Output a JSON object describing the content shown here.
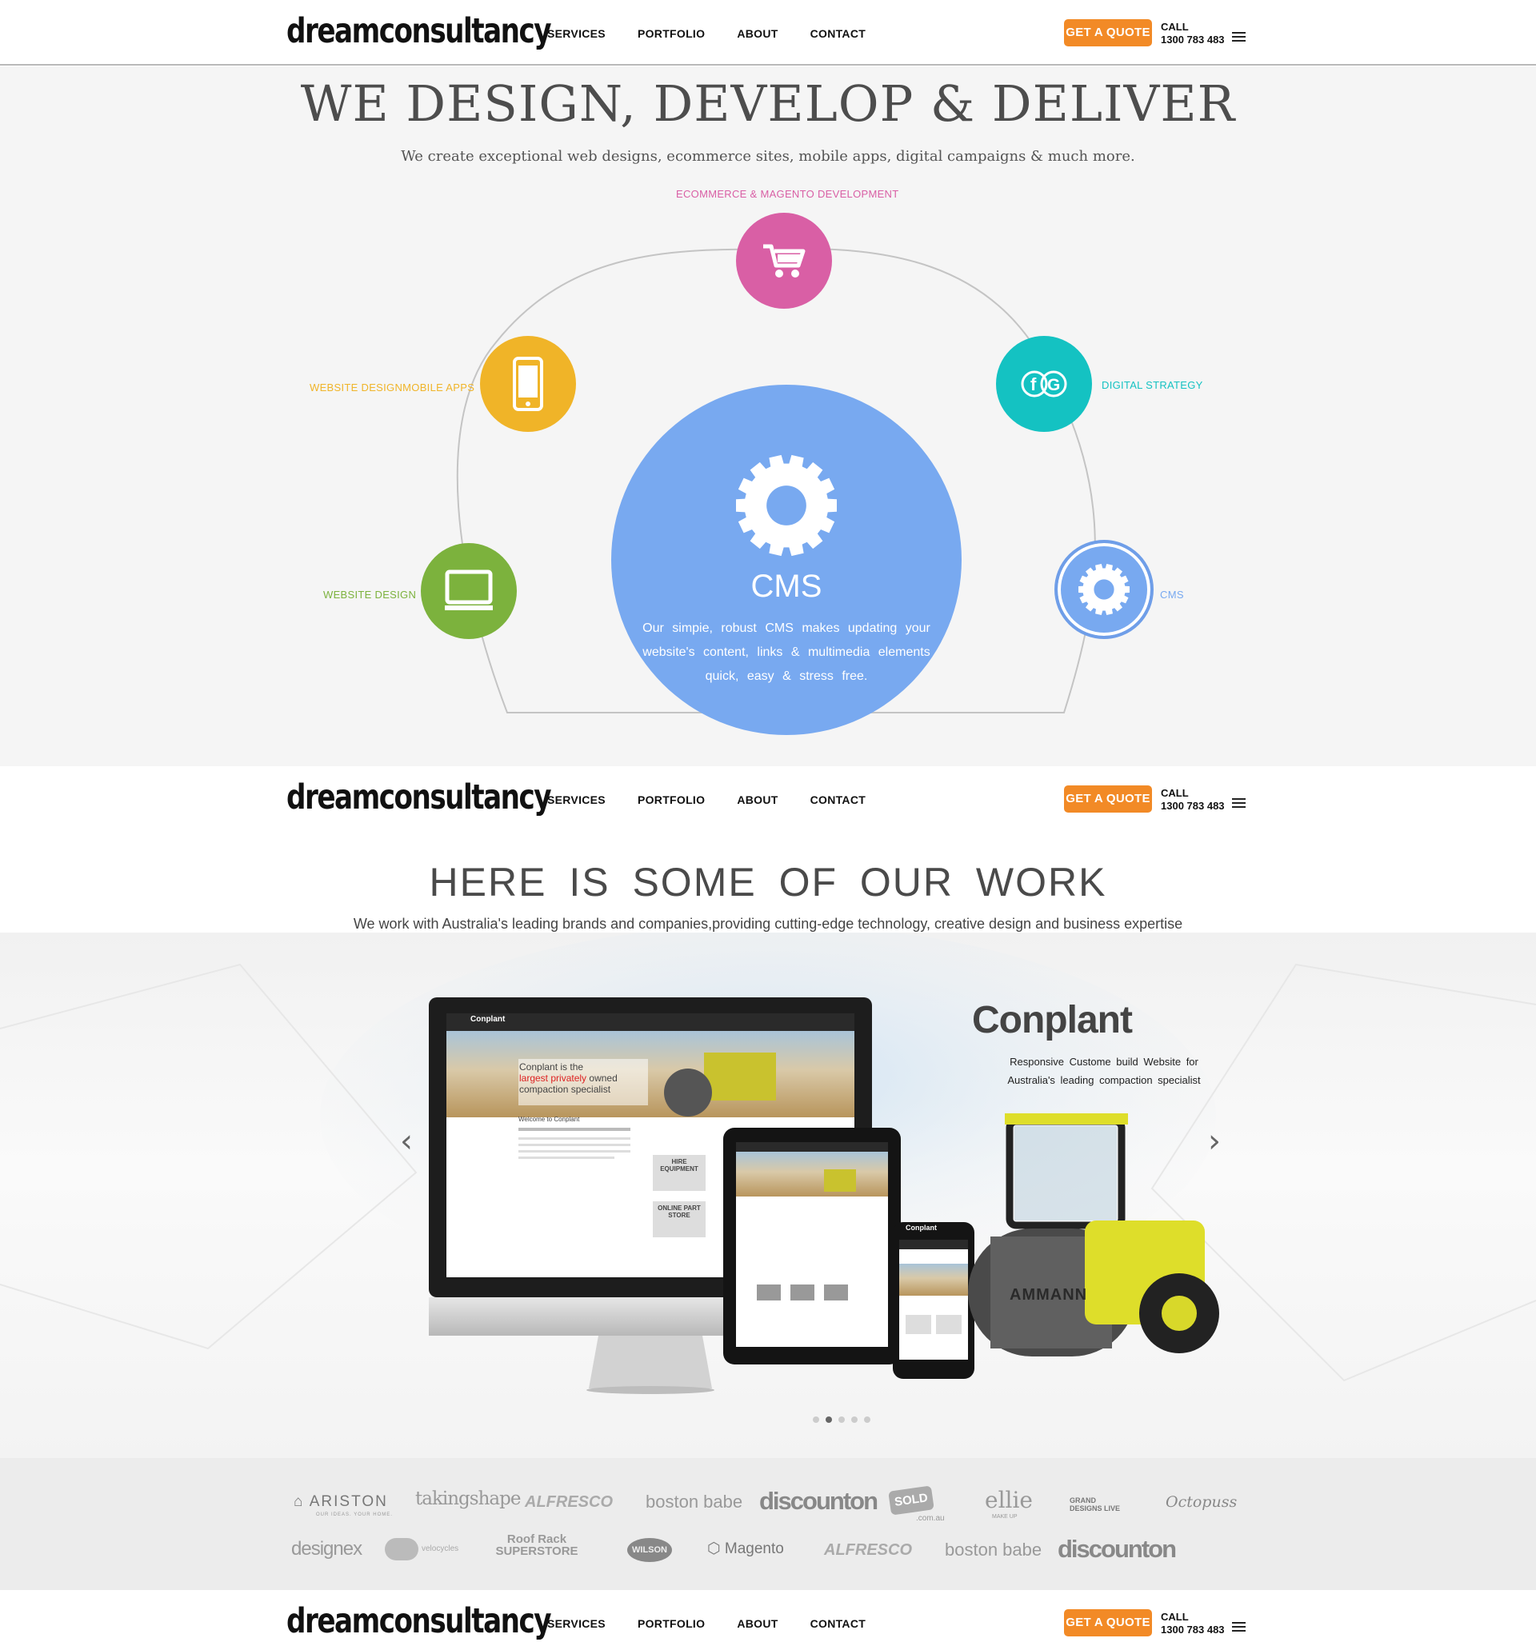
{
  "nav": {
    "logo": "dreamconsultancy",
    "items": [
      "SERVICES",
      "PORTFOLIO",
      "ABOUT",
      "CONTACT"
    ],
    "quote": "GET A QUOTE",
    "call_label": "CALL",
    "phone": "1300 783 483"
  },
  "hero": {
    "title": "WE DESIGN, DEVELOP & DELIVER",
    "subtitle": "We create exceptional web designs, ecommerce sites, mobile apps, digital campaigns & much more.",
    "services": {
      "ecommerce": {
        "label": "ECOMMERCE & MAGENTO DEVELOPMENT",
        "color": "#d95fa5",
        "icon": "cart-icon"
      },
      "mobile": {
        "label": "WEBSITE DESIGNMOBILE APPS",
        "color": "#f0b428",
        "icon": "phone-icon"
      },
      "digital": {
        "label": "DIGITAL STRATEGY",
        "color": "#14c2c2",
        "icon": "social-icon"
      },
      "design": {
        "label": "WEBSITE DESIGN",
        "color": "#7cb23d",
        "icon": "monitor-icon"
      },
      "cms": {
        "label": "CMS",
        "color": "#78a9f0",
        "icon": "gear-icon"
      }
    },
    "feature": {
      "title": "CMS",
      "description": "Our simpie, robust CMS makes updating your website's content, links & multimedia elements quick, easy & stress free."
    }
  },
  "work": {
    "title": "HERE IS SOME OF OUR WORK",
    "subtitle": "We work with Australia's leading brands and companies,providing cutting-edge technology, creative design and business expertise",
    "slide": {
      "brand": "Conplant",
      "description": "Responsive Custome build Website for Australia's leading compaction specialist",
      "mock_hero_line1": "Conplant is the",
      "mock_hero_line2": "largest privately",
      "mock_hero_line3": "owned",
      "mock_hero_line4": "compaction specialist",
      "mock_machine_brand": "AMMANN",
      "mock_sign_hire": "HIRE EQUIPMENT",
      "mock_sign_store": "ONLINE PART STORE",
      "mock_welcome": "Welcome to Conplant"
    },
    "prev": "‹",
    "next": "›",
    "active_slide": 2,
    "slide_count": 5
  },
  "clients": {
    "row1": [
      "ARISTON",
      "takingshape",
      "ALFRESCO",
      "boston babe",
      "discounton",
      "SOLD",
      "ellie",
      "GRAND DESIGNS LIVE",
      "Octopuss"
    ],
    "row2": [
      "designex",
      "velocycles",
      "Roof Rack SUPERSTORE",
      "WILSON",
      "Magento",
      "ALFRESCO",
      "boston babe",
      "discounton"
    ],
    "ariston_tagline": "OUR IDEAS. YOUR HOME.",
    "sold_suffix": ".com.au",
    "ellie_tagline": "MAKE UP"
  }
}
